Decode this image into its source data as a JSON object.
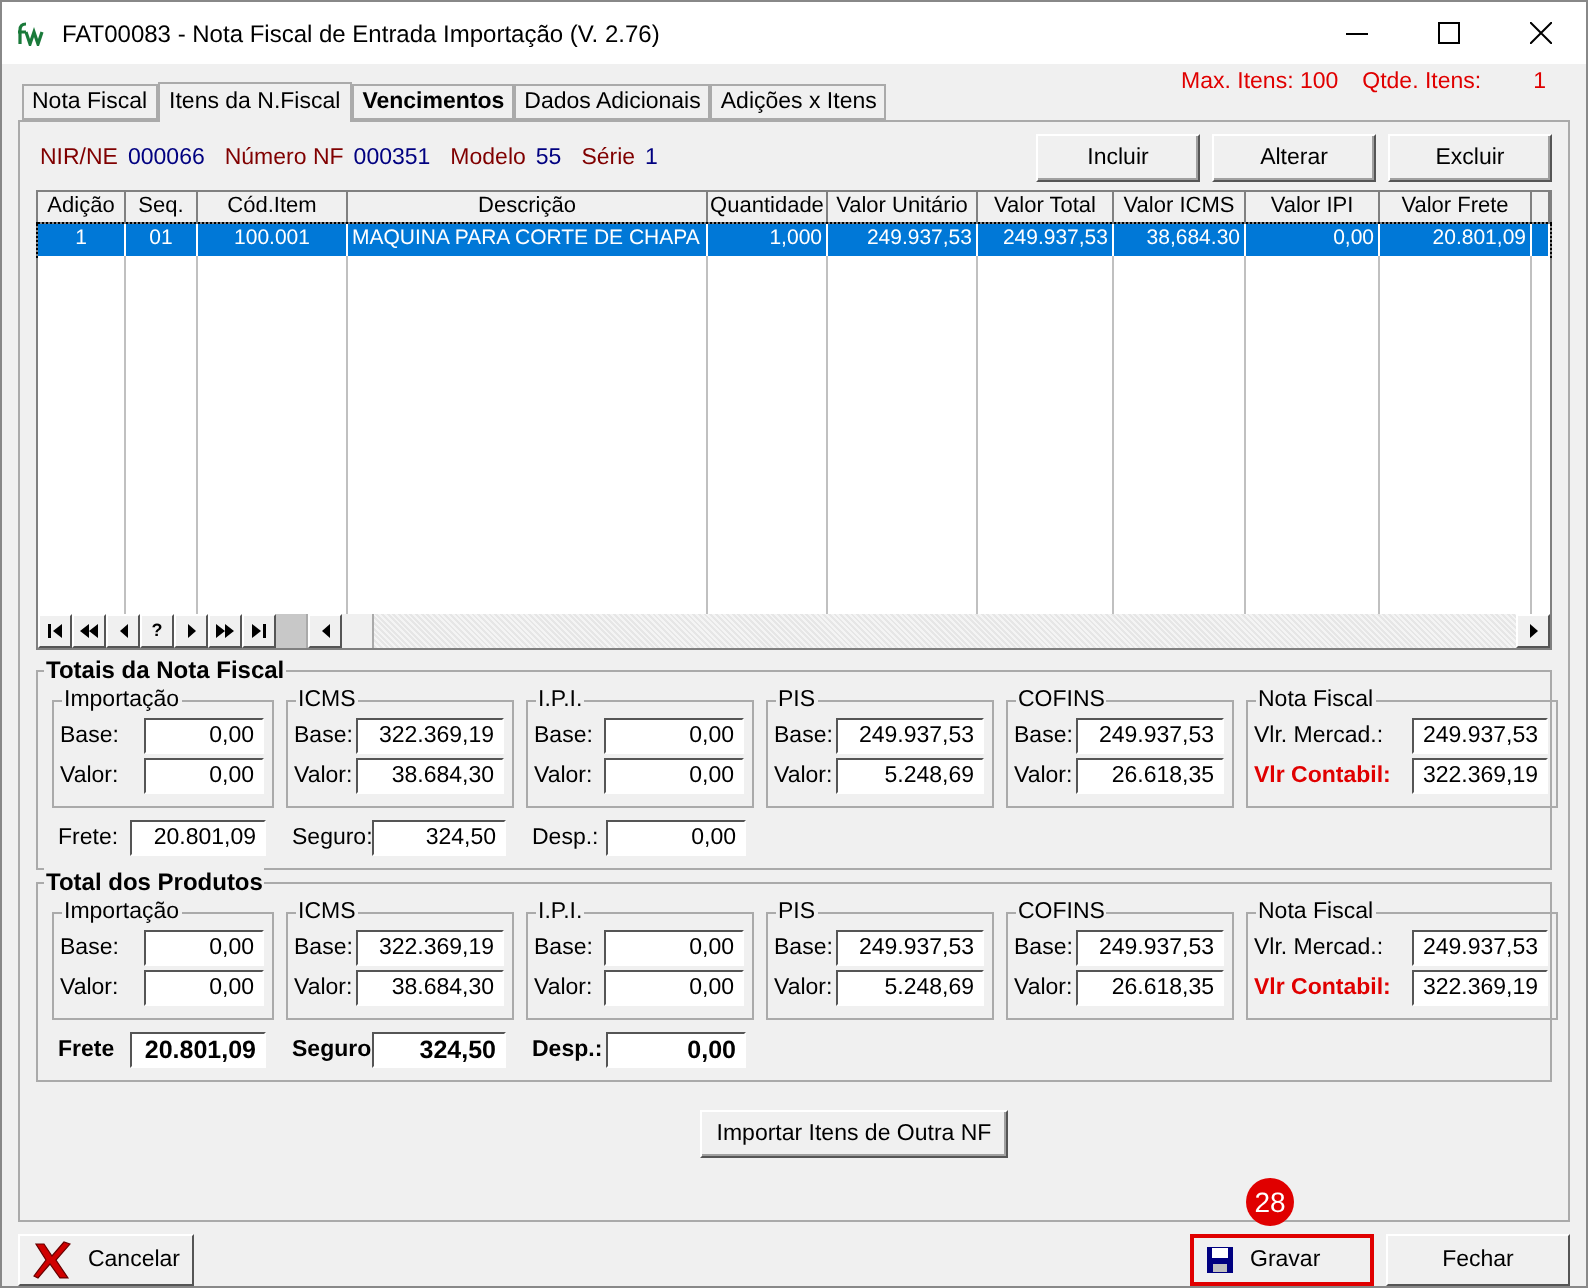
{
  "window": {
    "title": "FAT00083 - Nota Fiscal de Entrada Importação (V. 2.76)"
  },
  "tabs": [
    {
      "label": "Nota Fiscal",
      "selected": false,
      "bold": false
    },
    {
      "label": "Itens da N.Fiscal",
      "selected": true,
      "bold": false
    },
    {
      "label": "Vencimentos",
      "selected": false,
      "bold": true
    },
    {
      "label": "Dados Adicionais",
      "selected": false,
      "bold": false
    },
    {
      "label": "Adições x Itens",
      "selected": false,
      "bold": false
    }
  ],
  "counters": {
    "max": "Max. Itens: 100",
    "qtde_label": "Qtde. Itens:",
    "qtde": "1"
  },
  "header": [
    {
      "label": "NIR/NE",
      "value": "000066"
    },
    {
      "label": "Número NF",
      "value": "000351"
    },
    {
      "label": "Modelo",
      "value": "55"
    },
    {
      "label": "Série",
      "value": "1"
    }
  ],
  "actions": [
    "Incluir",
    "Alterar",
    "Excluir"
  ],
  "table": {
    "columns": [
      "Adição",
      "Seq.",
      "Cód.Item",
      "Descrição",
      "Quantidade",
      "Valor Unitário",
      "Valor Total",
      "Valor ICMS",
      "Valor IPI",
      "Valor Frete"
    ],
    "rows": [
      {
        "selected": true,
        "cells": [
          "1",
          "01",
          "100.001",
          "MAQUINA PARA CORTE DE CHAPA",
          "1,000",
          "249.937,53",
          "249.937,53",
          "38,684.30",
          "0,00",
          "20.801,09"
        ]
      }
    ]
  },
  "navigator": [
    {
      "kind": "first"
    },
    {
      "kind": "prior-page"
    },
    {
      "kind": "prior"
    },
    {
      "kind": "text",
      "label": "?"
    },
    {
      "kind": "next"
    },
    {
      "kind": "next-page"
    },
    {
      "kind": "last"
    }
  ],
  "sections": [
    {
      "title": "Totais da Nota Fiscal",
      "bold_footer": false,
      "groups": [
        {
          "title": "Importação",
          "rows": [
            {
              "label": "Base:",
              "value": "0,00",
              "emphasis": false
            },
            {
              "label": "Valor:",
              "value": "0,00",
              "emphasis": false
            }
          ]
        },
        {
          "title": "ICMS",
          "rows": [
            {
              "label": "Base:",
              "value": "322.369,19",
              "emphasis": false
            },
            {
              "label": "Valor:",
              "value": "38.684,30",
              "emphasis": false
            }
          ]
        },
        {
          "title": "I.P.I.",
          "rows": [
            {
              "label": "Base:",
              "value": "0,00",
              "emphasis": false
            },
            {
              "label": "Valor:",
              "value": "0,00",
              "emphasis": false
            }
          ]
        },
        {
          "title": "PIS",
          "rows": [
            {
              "label": "Base:",
              "value": "249.937,53",
              "emphasis": false
            },
            {
              "label": "Valor:",
              "value": "5.248,69",
              "emphasis": false
            }
          ]
        },
        {
          "title": "COFINS",
          "rows": [
            {
              "label": "Base:",
              "value": "249.937,53",
              "emphasis": false
            },
            {
              "label": "Valor:",
              "value": "26.618,35",
              "emphasis": false
            }
          ]
        },
        {
          "title": "Nota Fiscal",
          "rows": [
            {
              "label": "Vlr. Mercad.:",
              "value": "249.937,53",
              "emphasis": false
            },
            {
              "label": "Vlr Contabil:",
              "value": "322.369,19",
              "emphasis": true
            }
          ]
        }
      ],
      "footer": [
        {
          "label": "Frete:",
          "value": "20.801,09"
        },
        {
          "label": "Seguro:",
          "value": "324,50"
        },
        {
          "label": "Desp.:",
          "value": "0,00"
        }
      ]
    },
    {
      "title": "Total dos Produtos",
      "bold_footer": true,
      "groups": [
        {
          "title": "Importação",
          "rows": [
            {
              "label": "Base:",
              "value": "0,00",
              "emphasis": false
            },
            {
              "label": "Valor:",
              "value": "0,00",
              "emphasis": false
            }
          ]
        },
        {
          "title": "ICMS",
          "rows": [
            {
              "label": "Base:",
              "value": "322.369,19",
              "emphasis": false
            },
            {
              "label": "Valor:",
              "value": "38.684,30",
              "emphasis": false
            }
          ]
        },
        {
          "title": "I.P.I.",
          "rows": [
            {
              "label": "Base:",
              "value": "0,00",
              "emphasis": false
            },
            {
              "label": "Valor:",
              "value": "0,00",
              "emphasis": false
            }
          ]
        },
        {
          "title": "PIS",
          "rows": [
            {
              "label": "Base:",
              "value": "249.937,53",
              "emphasis": false
            },
            {
              "label": "Valor:",
              "value": "5.248,69",
              "emphasis": false
            }
          ]
        },
        {
          "title": "COFINS",
          "rows": [
            {
              "label": "Base:",
              "value": "249.937,53",
              "emphasis": false
            },
            {
              "label": "Valor:",
              "value": "26.618,35",
              "emphasis": false
            }
          ]
        },
        {
          "title": "Nota Fiscal",
          "rows": [
            {
              "label": "Vlr. Mercad.:",
              "value": "249.937,53",
              "emphasis": false
            },
            {
              "label": "Vlr Contabil:",
              "value": "322.369,19",
              "emphasis": true
            }
          ]
        }
      ],
      "footer": [
        {
          "label": "Frete",
          "value": "20.801,09"
        },
        {
          "label": "Seguro",
          "value": "324,50"
        },
        {
          "label": "Desp.:",
          "value": "0,00"
        }
      ]
    }
  ],
  "import_button": "Importar Itens de Outra NF",
  "bottom_buttons": [
    {
      "kind": "cancel",
      "label": "Cancelar",
      "highlighted": false
    },
    {
      "kind": "save",
      "label": "Gravar",
      "highlighted": true,
      "badge": "28"
    },
    {
      "kind": "plain",
      "label": "Fechar",
      "highlighted": false
    }
  ]
}
